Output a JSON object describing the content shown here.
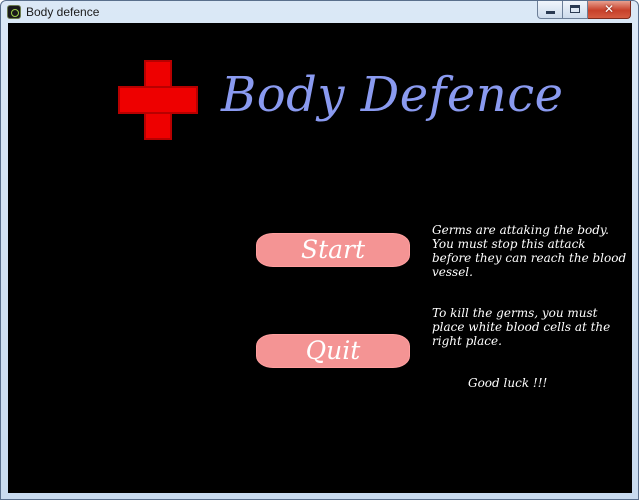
{
  "window": {
    "title": "Body defence",
    "close_glyph": "✕"
  },
  "game": {
    "title": "Body Defence",
    "logo_color": "#ee0000",
    "title_color": "#8a9af0",
    "button_color": "#f49494",
    "background_color": "#000000"
  },
  "menu": {
    "start_label": "Start",
    "quit_label": "Quit"
  },
  "instructions": {
    "paragraph1": "Germs are attaking the body. You must stop this attack before they can reach the blood vessel.",
    "paragraph2": "To kill the germs, you must place white blood cells at the right place.",
    "closing": "Good luck !!!"
  }
}
